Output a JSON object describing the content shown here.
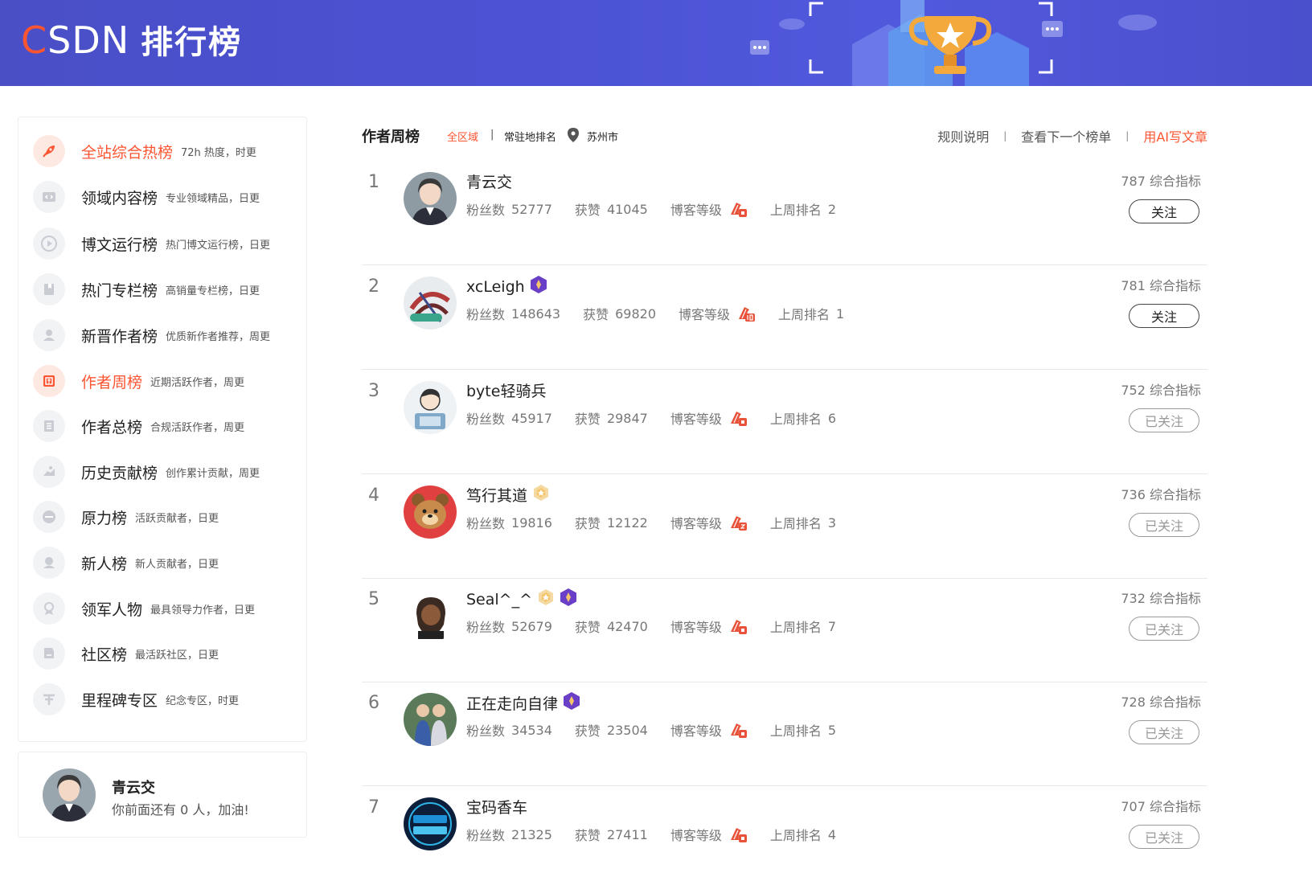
{
  "header": {
    "logo_c": "C",
    "logo_sdn": "SDN",
    "title": "排行榜"
  },
  "sidebar": {
    "items": [
      {
        "label": "全站综合热榜",
        "sub": "72h 热度，时更",
        "active": true,
        "icon": "rocket-icon"
      },
      {
        "label": "领域内容榜",
        "sub": "专业领域精品，日更",
        "active": false,
        "icon": "code-icon"
      },
      {
        "label": "博文运行榜",
        "sub": "热门博文运行榜，日更",
        "active": false,
        "icon": "play-icon"
      },
      {
        "label": "热门专栏榜",
        "sub": "高销量专栏榜，日更",
        "active": false,
        "icon": "bookmark-icon"
      },
      {
        "label": "新晋作者榜",
        "sub": "优质新作者推荐，周更",
        "active": false,
        "icon": "user-icon"
      },
      {
        "label": "作者周榜",
        "sub": "近期活跃作者，周更",
        "active": true,
        "icon": "week-icon"
      },
      {
        "label": "作者总榜",
        "sub": "合规活跃作者，周更",
        "active": false,
        "icon": "total-icon"
      },
      {
        "label": "历史贡献榜",
        "sub": "创作累计贡献，周更",
        "active": false,
        "icon": "hand-icon"
      },
      {
        "label": "原力榜",
        "sub": "活跃贡献者，日更",
        "active": false,
        "icon": "force-icon"
      },
      {
        "label": "新人榜",
        "sub": "新人贡献者，日更",
        "active": false,
        "icon": "newbie-icon"
      },
      {
        "label": "领军人物",
        "sub": "最具领导力作者，日更",
        "active": false,
        "icon": "medal-icon"
      },
      {
        "label": "社区榜",
        "sub": "最活跃社区，日更",
        "active": false,
        "icon": "flag-icon"
      },
      {
        "label": "里程碑专区",
        "sub": "纪念专区，时更",
        "active": false,
        "icon": "milestone-icon"
      }
    ]
  },
  "me": {
    "name": "青云交",
    "tip": "你前面还有 0 人，加油!"
  },
  "list_header": {
    "title": "作者周榜",
    "region": "全区域",
    "sep": "|",
    "resident": "常驻地排名",
    "city": "苏州市",
    "rules": "规则说明",
    "next": "查看下一个榜单",
    "ai": "用AI写文章",
    "link_sep": "|"
  },
  "labels": {
    "fans": "粉丝数",
    "likes": "获赞",
    "level": "博客等级",
    "last_rank": "上周排名",
    "score_suffix": "综合指标"
  },
  "authors": [
    {
      "rank": "1",
      "name": "青云交",
      "fans": "52777",
      "likes": "41045",
      "last": "2",
      "score": "787",
      "follow": "关注",
      "followed": false,
      "badges": []
    },
    {
      "rank": "2",
      "name": "xcLeigh",
      "fans": "148643",
      "likes": "69820",
      "last": "1",
      "score": "781",
      "follow": "关注",
      "followed": false,
      "badges": [
        "purple"
      ]
    },
    {
      "rank": "3",
      "name": "byte轻骑兵",
      "fans": "45917",
      "likes": "29847",
      "last": "6",
      "score": "752",
      "follow": "已关注",
      "followed": true,
      "badges": []
    },
    {
      "rank": "4",
      "name": "笃行其道",
      "fans": "19816",
      "likes": "12122",
      "last": "3",
      "score": "736",
      "follow": "已关注",
      "followed": true,
      "badges": [
        "gold"
      ]
    },
    {
      "rank": "5",
      "name": "Seal^_^",
      "fans": "52679",
      "likes": "42470",
      "last": "7",
      "score": "732",
      "follow": "已关注",
      "followed": true,
      "badges": [
        "gold",
        "purple"
      ]
    },
    {
      "rank": "6",
      "name": "正在走向自律",
      "fans": "34534",
      "likes": "23504",
      "last": "5",
      "score": "728",
      "follow": "已关注",
      "followed": true,
      "badges": [
        "purple"
      ]
    },
    {
      "rank": "7",
      "name": "宝码香车",
      "fans": "21325",
      "likes": "27411",
      "last": "4",
      "score": "707",
      "follow": "已关注",
      "followed": true,
      "badges": []
    }
  ],
  "colors": {
    "accent": "#fc5531",
    "banner": "#4b52d4",
    "badge_purple": "#6a3fc7",
    "badge_gold": "#f5c56b"
  }
}
